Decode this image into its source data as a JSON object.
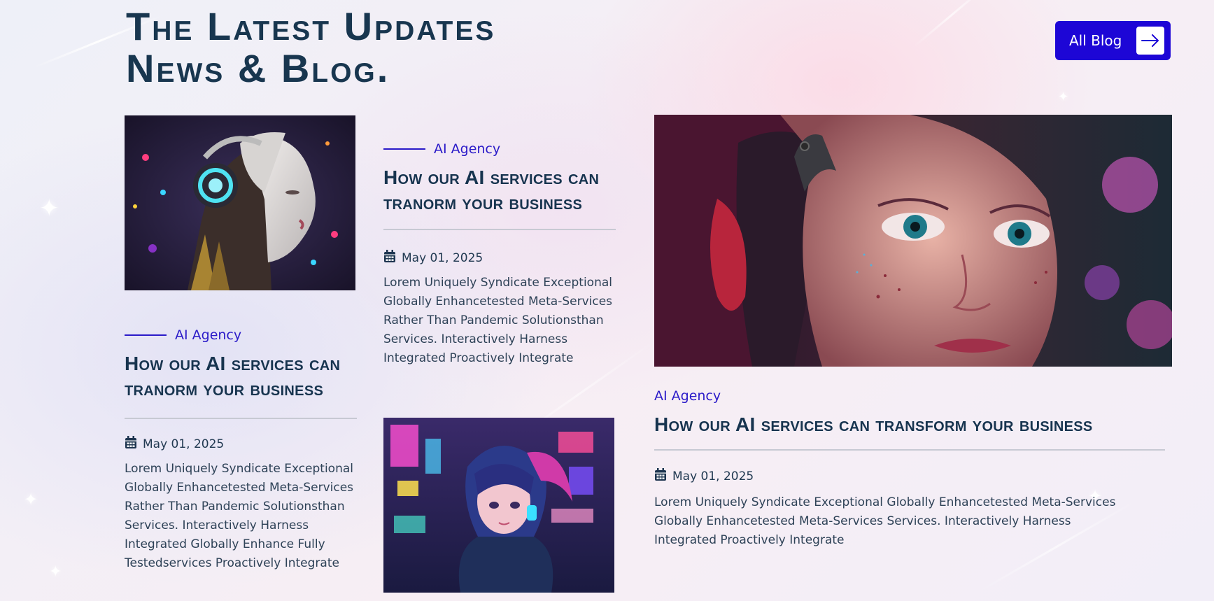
{
  "header": {
    "title_line1": "The Latest Updates",
    "title_line2": "News & Blog.",
    "all_blog_label": "All Blog"
  },
  "posts": [
    {
      "category": "AI Agency",
      "title_line1": "How our AI services can",
      "title_line2": "tranorm your business",
      "date": "May 01, 2025",
      "description": "Lorem Uniquely Syndicate Exceptional Globally Enhancetested Meta-Services Rather Than Pandemic Solutionsthan Services. Interactively Harness Integrated Globally Enhance Fully Testedservices Proactively Integrate"
    },
    {
      "category": "AI Agency",
      "title_line1": "How our AI services can",
      "title_line2": "tranorm your business",
      "date": "May 01, 2025",
      "description": "Lorem Uniquely Syndicate Exceptional Globally Enhancetested Meta-Services Rather Than Pandemic Solutionsthan Services. Interactively Harness Integrated Proactively Integrate"
    },
    {
      "category": "AI Agency",
      "title_line1": "How our AI services can transform your business",
      "date": "May 01, 2025",
      "description": "Lorem Uniquely Syndicate Exceptional Globally Enhancetested Meta-Services Globally Enhancetested Meta-Services Services. Interactively Harness Integrated Proactively Integrate"
    }
  ],
  "icons": {
    "arrow": "arrow-right-icon",
    "calendar": "calendar-icon"
  },
  "colors": {
    "accent": "#1d06d6",
    "heading": "#17344f",
    "category": "#2a1ac8"
  }
}
